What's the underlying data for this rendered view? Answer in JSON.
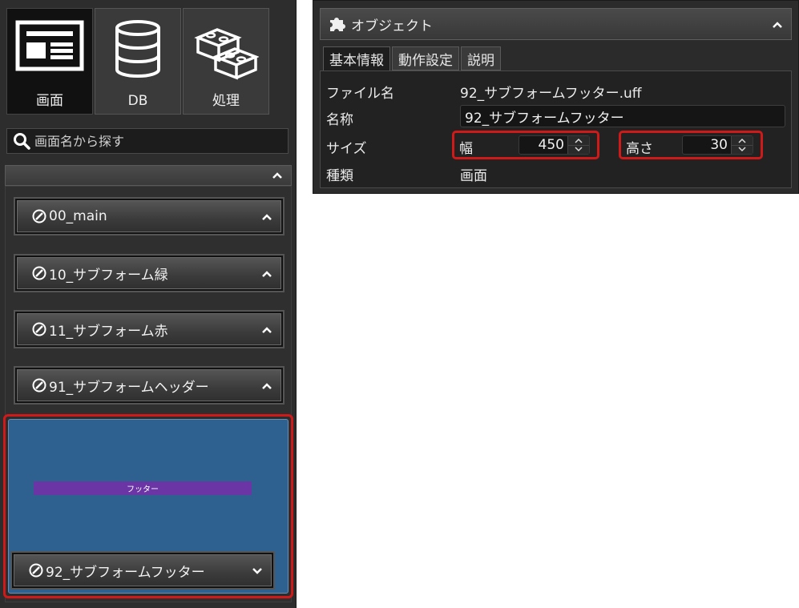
{
  "left": {
    "categories": [
      {
        "label": "画面",
        "icon": "screen-icon",
        "active": true
      },
      {
        "label": "DB",
        "icon": "database-icon",
        "active": false
      },
      {
        "label": "処理",
        "icon": "blocks-icon",
        "active": false
      }
    ],
    "search": {
      "placeholder": "画面名から探す",
      "icon": "search-icon"
    },
    "items": [
      {
        "label": "00_main",
        "state": "collapsed"
      },
      {
        "label": "10_サブフォーム緑",
        "state": "collapsed"
      },
      {
        "label": "11_サブフォーム赤",
        "state": "collapsed"
      },
      {
        "label": "91_サブフォームヘッダー",
        "state": "collapsed"
      }
    ],
    "selected": {
      "label": "92_サブフォームフッター",
      "preview_text": "フッター",
      "preview_bg": "#2e6090",
      "preview_bar": "#6b35a6"
    }
  },
  "right": {
    "header": {
      "title": "オブジェクト",
      "icon": "puzzle-icon"
    },
    "tabs": [
      {
        "label": "基本情報",
        "active": true
      },
      {
        "label": "動作設定",
        "active": false
      },
      {
        "label": "説明",
        "active": false
      }
    ],
    "props": {
      "filename_label": "ファイル名",
      "filename_value": "92_サブフォームフッター.uff",
      "name_label": "名称",
      "name_value": "92_サブフォームフッター",
      "size_label": "サイズ",
      "width_label": "幅",
      "width_value": "450",
      "height_label": "高さ",
      "height_value": "30",
      "type_label": "種類",
      "type_value": "画面"
    }
  },
  "colors": {
    "highlight": "#d01a1a",
    "panel_bg": "#2d2d2d"
  }
}
